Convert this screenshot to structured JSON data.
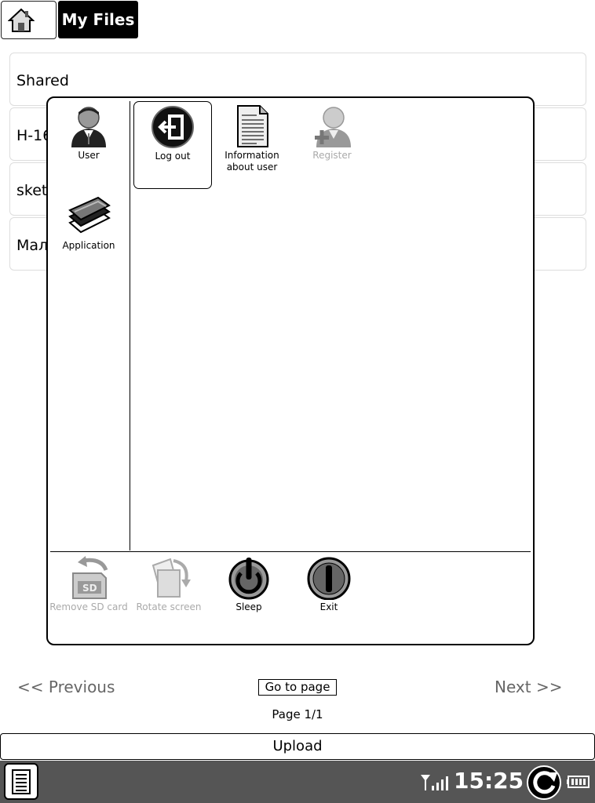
{
  "header": {
    "title": "My Files"
  },
  "files": [
    "Shared",
    "H-16",
    "sket",
    "Мал"
  ],
  "dialog": {
    "categories": [
      {
        "label": "User",
        "icon": "user-icon"
      },
      {
        "label": "Application",
        "icon": "application-icon"
      }
    ],
    "actions": [
      {
        "label": "Log out",
        "icon": "logout-icon",
        "selected": true,
        "enabled": true
      },
      {
        "label": "Information about user",
        "icon": "document-icon",
        "selected": false,
        "enabled": true
      },
      {
        "label": "Register",
        "icon": "add-user-icon",
        "selected": false,
        "enabled": false
      }
    ],
    "system": [
      {
        "label": "Remove SD card",
        "icon": "sd-card-icon",
        "enabled": false
      },
      {
        "label": "Rotate screen",
        "icon": "rotate-screen-icon",
        "enabled": false
      },
      {
        "label": "Sleep",
        "icon": "power-sleep-icon",
        "enabled": true
      },
      {
        "label": "Exit",
        "icon": "exit-icon",
        "enabled": true
      }
    ]
  },
  "pagination": {
    "previous": "<< Previous",
    "goto": "Go to page",
    "next": "Next >>",
    "page_info": "Page 1/1"
  },
  "upload_label": "Upload",
  "status": {
    "time": "15:25"
  }
}
